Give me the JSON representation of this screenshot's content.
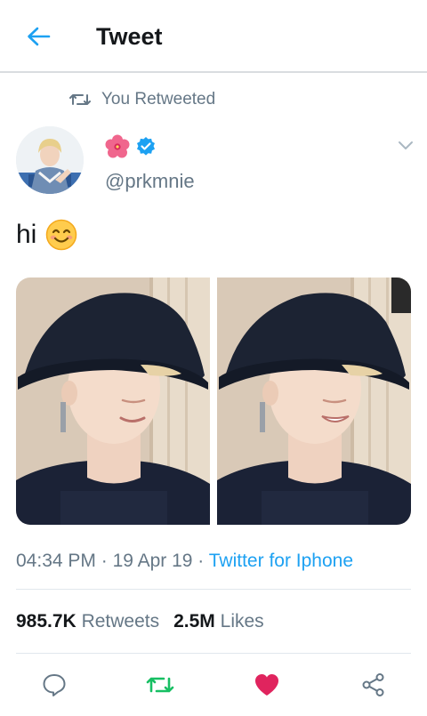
{
  "header": {
    "title": "Tweet",
    "back_icon": "arrow-left-icon"
  },
  "retweet_note": {
    "text": "You Retweeted",
    "icon": "retweet-icon"
  },
  "author": {
    "display_name_icon": "hibiscus-flower-emoji",
    "verified_icon": "verified-badge-icon",
    "handle": "@prkmnie",
    "avatar": "avatar"
  },
  "tweet": {
    "text": "hi",
    "emoji": "smiling-face-emoji",
    "photos": [
      "photo-1",
      "photo-2"
    ]
  },
  "meta": {
    "time": "04:34 PM",
    "sep1": " · ",
    "date": "19 Apr 19",
    "sep2": " · ",
    "source": "Twitter for Iphone"
  },
  "stats": {
    "retweets_count": "985.7K",
    "retweets_label": "Retweets",
    "likes_count": "2.5M",
    "likes_label": "Likes"
  },
  "actions": {
    "reply_icon": "reply-icon",
    "retweet_icon": "retweet-icon",
    "like_icon": "heart-icon",
    "share_icon": "share-icon"
  },
  "colors": {
    "accent": "#1da1f2",
    "retweet_active": "#17bf63",
    "like_active": "#e0245e",
    "muted": "#657786"
  }
}
